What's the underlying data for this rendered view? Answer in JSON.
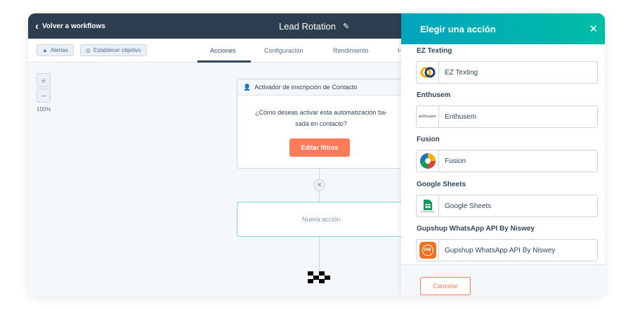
{
  "topbar": {
    "back_label": "Volver a workflows",
    "workflow_title": "Lead Rotation"
  },
  "subbar": {
    "alerts_label": "Alertas",
    "goal_label": "Establecer objetivo",
    "tabs": [
      {
        "label": "Acciones",
        "active": true
      },
      {
        "label": "Configuración",
        "active": false
      },
      {
        "label": "Rendimiento",
        "active": false
      },
      {
        "label": "H",
        "active": false
      }
    ]
  },
  "canvas": {
    "zoom_level": "100%",
    "trigger_card": {
      "header": "Activador de inscripción de Contacto",
      "question_line1": "¿Cómo deseas activar esta automatización ba-",
      "question_line2": "sada en contacto?",
      "button_label": "Editar filtros"
    },
    "new_action_label": "Nueva acción"
  },
  "panel": {
    "title": "Elegir una acción",
    "sections": [
      {
        "heading": "EZ Texting",
        "app": "EZ Texting",
        "logo": "ez-texting-logo"
      },
      {
        "heading": "Enthusem",
        "app": "Enthusem",
        "logo": "enthusem-logo",
        "logo_text": "enthusem"
      },
      {
        "heading": "Fusion",
        "app": "Fusion",
        "logo": "fusion-logo"
      },
      {
        "heading": "Google Sheets",
        "app": "Google Sheets",
        "logo": "google-sheets-logo",
        "logo_text": "Google Sheets"
      },
      {
        "heading": "Gupshup WhatsApp API By Niswey",
        "app": "Gupshup WhatsApp API By Niswey",
        "logo": "gupshup-logo",
        "logo_text": "HW"
      }
    ],
    "cancel_label": "Cancelar"
  },
  "colors": {
    "topbar": "#2d3e50",
    "accent_orange": "#ff7a59",
    "panel_gradient_start": "#00a4bd",
    "panel_gradient_end": "#00bda5"
  }
}
